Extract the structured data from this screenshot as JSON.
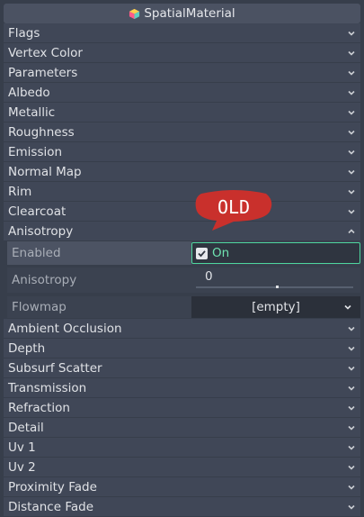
{
  "title": "SpatialMaterial",
  "sections_top": [
    {
      "label": "Flags"
    },
    {
      "label": "Vertex Color"
    },
    {
      "label": "Parameters"
    },
    {
      "label": "Albedo"
    },
    {
      "label": "Metallic"
    },
    {
      "label": "Roughness"
    },
    {
      "label": "Emission"
    },
    {
      "label": "Normal Map"
    },
    {
      "label": "Rim"
    },
    {
      "label": "Clearcoat"
    }
  ],
  "anisotropy_section": {
    "label": "Anisotropy",
    "expanded": true
  },
  "anisotropy_props": {
    "enabled_label": "Enabled",
    "enabled_value": "On",
    "anisotropy_label": "Anisotropy",
    "anisotropy_value": "0",
    "flowmap_label": "Flowmap",
    "flowmap_value": "[empty]"
  },
  "sections_bottom": [
    {
      "label": "Ambient Occlusion"
    },
    {
      "label": "Depth"
    },
    {
      "label": "Subsurf Scatter"
    },
    {
      "label": "Transmission"
    },
    {
      "label": "Refraction"
    },
    {
      "label": "Detail"
    },
    {
      "label": "Uv 1"
    },
    {
      "label": "Uv 2"
    },
    {
      "label": "Proximity Fade"
    },
    {
      "label": "Distance Fade"
    }
  ],
  "badge": {
    "text": "OLD",
    "color": "#c9302c"
  },
  "colors": {
    "accent": "#4ed69e",
    "background": "#373e4b",
    "section_bg": "#404757"
  },
  "icons": {
    "title": "material-cube-icon",
    "section": "chevron-down-icon",
    "expanded": "chevron-up-icon",
    "check": "checkmark-icon"
  }
}
